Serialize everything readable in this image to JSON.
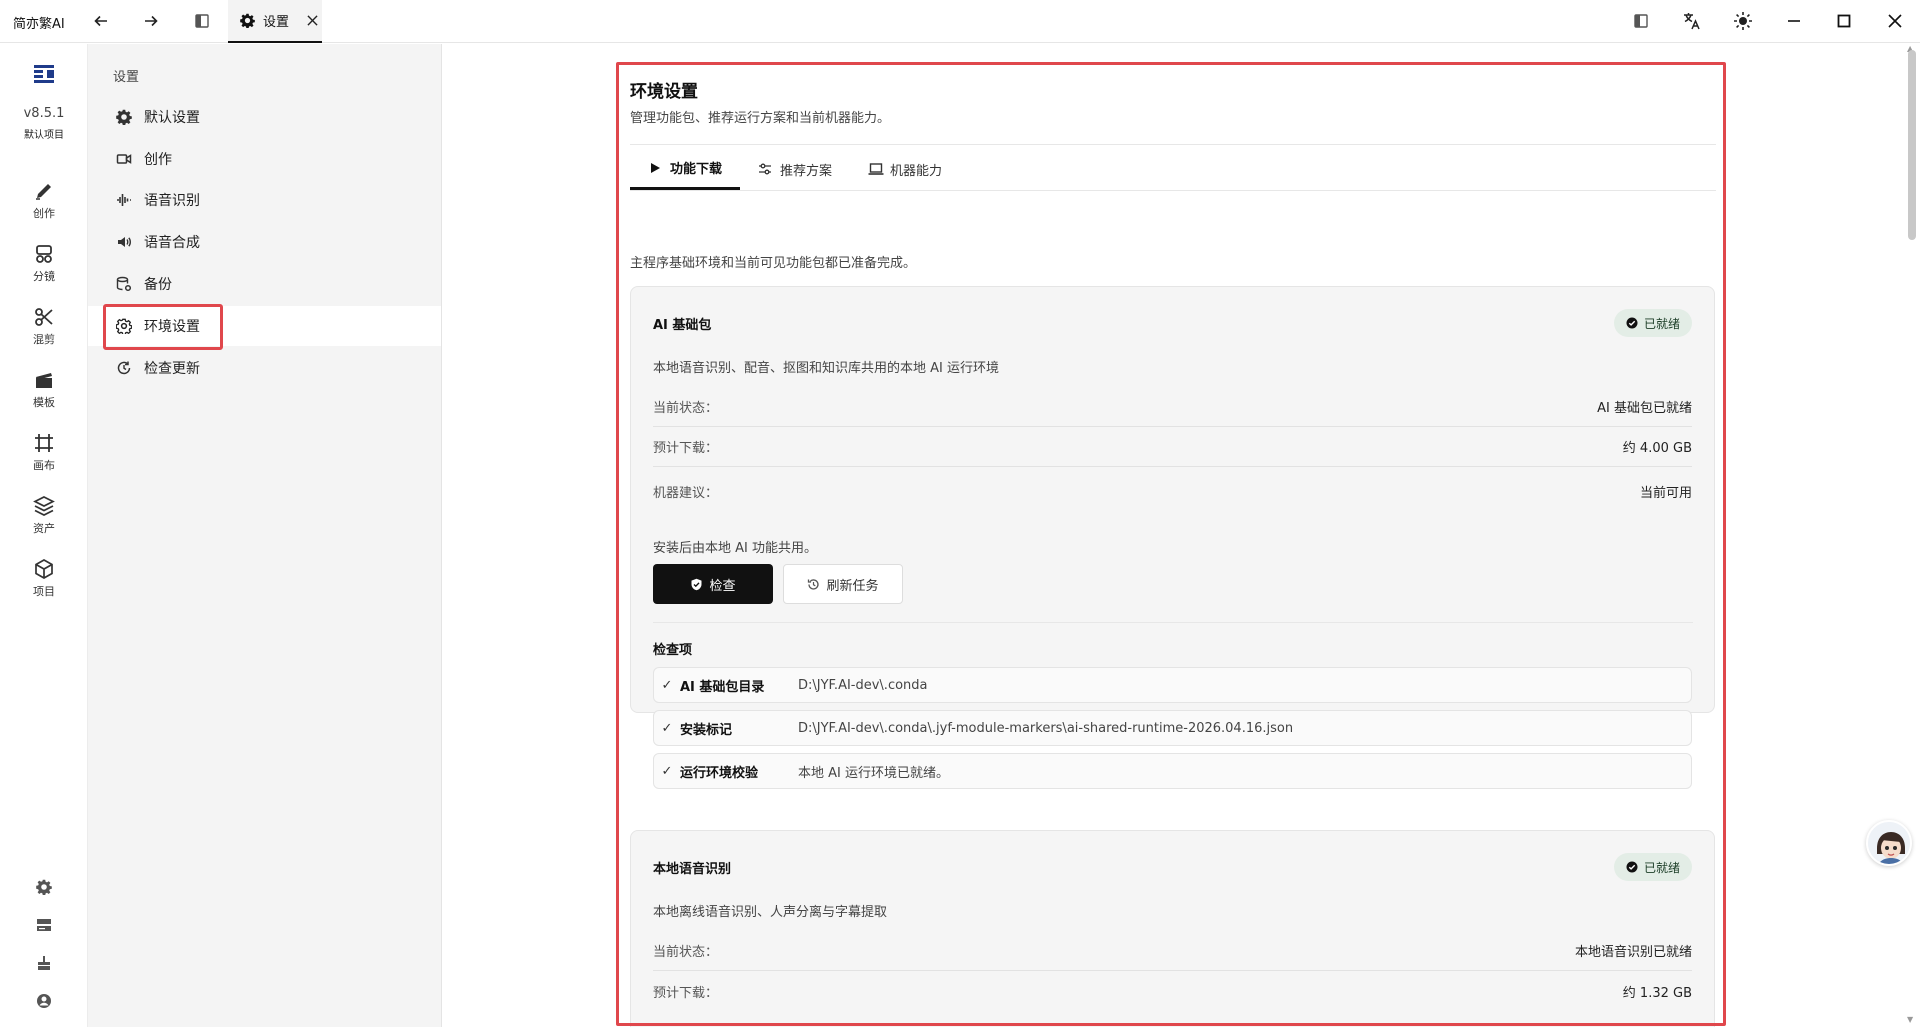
{
  "titlebar": {
    "app_name": "简亦繁AI",
    "tab_label": "设置"
  },
  "rail": {
    "version": "v8.5.1",
    "project": "默认项目",
    "items": [
      {
        "label": "创作",
        "icon": "pencil-icon"
      },
      {
        "label": "分镜",
        "icon": "storyboard-icon"
      },
      {
        "label": "混剪",
        "icon": "scissors-icon"
      },
      {
        "label": "模板",
        "icon": "clapperboard-icon"
      },
      {
        "label": "画布",
        "icon": "crop-frame-icon"
      },
      {
        "label": "资产",
        "icon": "layers-icon"
      },
      {
        "label": "项目",
        "icon": "cube-icon"
      }
    ]
  },
  "settings_nav": {
    "title": "设置",
    "items": [
      {
        "label": "默认设置",
        "icon": "gear-icon"
      },
      {
        "label": "创作",
        "icon": "video-camera-icon"
      },
      {
        "label": "语音识别",
        "icon": "waveform-icon"
      },
      {
        "label": "语音合成",
        "icon": "speaker-icon"
      },
      {
        "label": "备份",
        "icon": "database-gear-icon"
      },
      {
        "label": "环境设置",
        "icon": "gear-outline-icon",
        "active": true
      },
      {
        "label": "检查更新",
        "icon": "refresh-icon"
      }
    ]
  },
  "env": {
    "title": "环境设置",
    "subtitle": "管理功能包、推荐运行方案和当前机器能力。",
    "tabs": [
      {
        "label": "功能下载",
        "icon": "play-icon",
        "active": true
      },
      {
        "label": "推荐方案",
        "icon": "sliders-icon"
      },
      {
        "label": "机器能力",
        "icon": "laptop-icon"
      }
    ],
    "ready_note": "主程序基础环境和当前可见功能包都已准备完成。",
    "cards": [
      {
        "title": "AI 基础包",
        "badge": "已就绪",
        "desc": "本地语音识别、配音、抠图和知识库共用的本地 AI 运行环境",
        "rows": [
          {
            "k": "当前状态：",
            "v": "AI 基础包已就绪"
          },
          {
            "k": "预计下载：",
            "v": "约 4.00 GB"
          },
          {
            "k": "机器建议：",
            "v": "当前可用"
          }
        ],
        "note": "安装后由本地 AI 功能共用。",
        "primary_btn": "检查",
        "secondary_btn": "刷新任务",
        "checks_title": "检查项",
        "checks": [
          {
            "mark": "✓",
            "name": "AI 基础包目录",
            "value": "D:\\JYF.AI-dev\\.conda"
          },
          {
            "mark": "✓",
            "name": "安装标记",
            "value": "D:\\JYF.AI-dev\\.conda\\.jyf-module-markers\\ai-shared-runtime-2026.04.16.json"
          },
          {
            "mark": "✓",
            "name": "运行环境校验",
            "value": "本地 AI 运行环境已就绪。"
          }
        ]
      },
      {
        "title": "本地语音识别",
        "badge": "已就绪",
        "desc": "本地离线语音识别、人声分离与字幕提取",
        "rows": [
          {
            "k": "当前状态：",
            "v": "本地语音识别已就绪"
          },
          {
            "k": "预计下载：",
            "v": "约 1.32 GB"
          }
        ]
      }
    ]
  },
  "colors": {
    "highlight": "#e0474c",
    "badge_bg": "#e3ede6",
    "primary": "#111111"
  }
}
